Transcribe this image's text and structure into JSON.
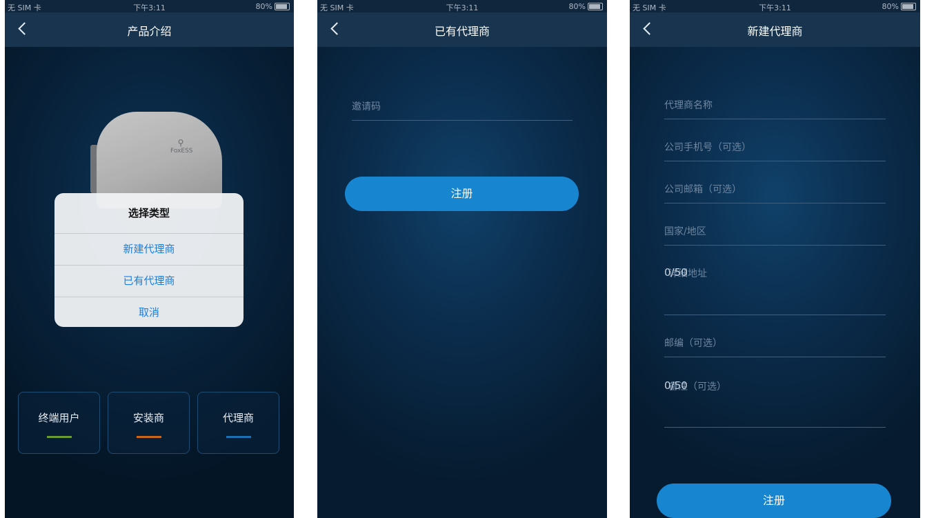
{
  "status": {
    "carrier": "无 SIM 卡",
    "time": "下午3:11",
    "battery": "80%"
  },
  "screen1": {
    "title": "产品介绍",
    "device_logo": "FoxESS",
    "dialog": {
      "title": "选择类型",
      "options": [
        "新建代理商",
        "已有代理商",
        "取消"
      ]
    },
    "roles": [
      {
        "label": "终端用户",
        "color": "#6a9a34"
      },
      {
        "label": "安装商",
        "color": "#c8671b"
      },
      {
        "label": "代理商",
        "color": "#1c6fb3"
      }
    ]
  },
  "screen2": {
    "title": "已有代理商",
    "invite_placeholder": "邀请码",
    "register": "注册"
  },
  "screen3": {
    "title": "新建代理商",
    "fields": {
      "name": "代理商名称",
      "phone": "公司手机号（可选）",
      "email": "公司邮箱（可选）",
      "country": "国家/地区",
      "address": "详细地址",
      "address_counter": "0/50",
      "zip": "邮编（可选）",
      "remark": "备注（可选）",
      "remark_counter": "0/50"
    },
    "register": "注册"
  },
  "colors": {
    "accent": "#1785cf",
    "nav": "#18344f",
    "link": "#1a7ee0"
  }
}
